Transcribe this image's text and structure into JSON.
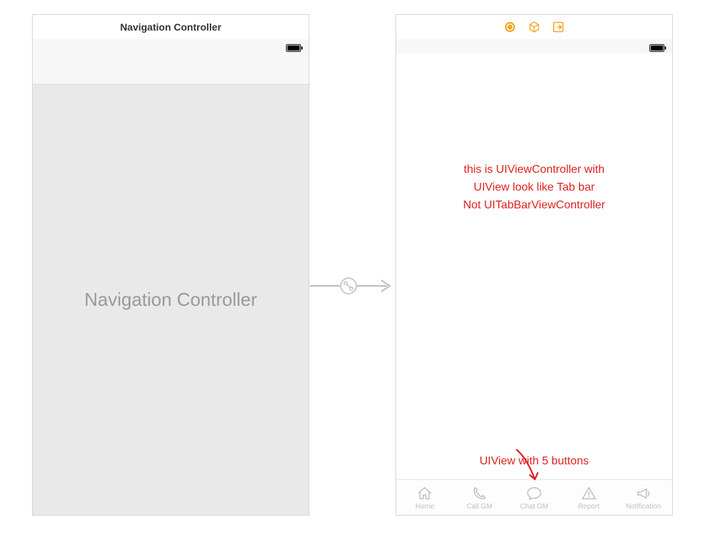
{
  "left_scene": {
    "title": "Navigation Controller",
    "placeholder": "Navigation Controller"
  },
  "right_scene": {
    "title_icons": [
      "coin-icon",
      "cube-icon",
      "logout-icon"
    ],
    "annotation_lines": {
      "l1": "this is UIViewController with",
      "l2": "UIView look like Tab bar",
      "l3": "Not UITabBarViewController"
    },
    "annotation_bottom": "UIView with 5 buttons",
    "tabs": [
      {
        "icon": "home-icon",
        "label": "Home"
      },
      {
        "icon": "phone-icon",
        "label": "Call GM"
      },
      {
        "icon": "chat-icon",
        "label": "Chat GM"
      },
      {
        "icon": "warning-icon",
        "label": "Report"
      },
      {
        "icon": "megaphone-icon",
        "label": "Notification"
      }
    ]
  },
  "colors": {
    "accent": "#e02020",
    "orange": "#f5a623",
    "muted": "#bfbfbf"
  }
}
